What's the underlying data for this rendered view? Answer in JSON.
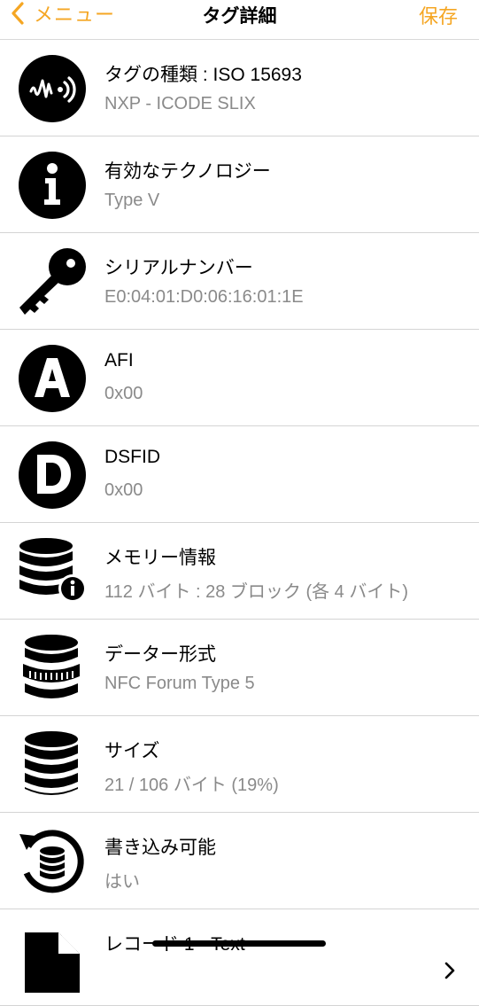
{
  "nav": {
    "back_label": "メニュー",
    "title": "タグ詳細",
    "save_label": "保存",
    "accent": "#f5a623"
  },
  "rows": [
    {
      "icon": "nfc-signal-icon",
      "title": "タグの種類 : ISO 15693",
      "value": "NXP - ICODE SLIX"
    },
    {
      "icon": "info-icon",
      "title": "有効なテクノロジー",
      "value": "Type V"
    },
    {
      "icon": "key-icon",
      "title": "シリアルナンバー",
      "value": "E0:04:01:D0:06:16:01:1E"
    },
    {
      "icon": "letter-a-icon",
      "title": "AFI",
      "value": "0x00"
    },
    {
      "icon": "letter-d-icon",
      "title": "DSFID",
      "value": "0x00"
    },
    {
      "icon": "database-info-icon",
      "title": "メモリー情報",
      "value": "112 バイト : 28 ブロック (各 4 バイト)"
    },
    {
      "icon": "database-format-icon",
      "title": "データー形式",
      "value": "NFC Forum Type 5"
    },
    {
      "icon": "database-icon",
      "title": "サイズ",
      "value": "21 / 106 バイト (19%)"
    },
    {
      "icon": "database-refresh-icon",
      "title": "書き込み可能",
      "value": "はい"
    },
    {
      "icon": "document-icon",
      "title": "レコード 1 - Text",
      "value": ""
    }
  ]
}
